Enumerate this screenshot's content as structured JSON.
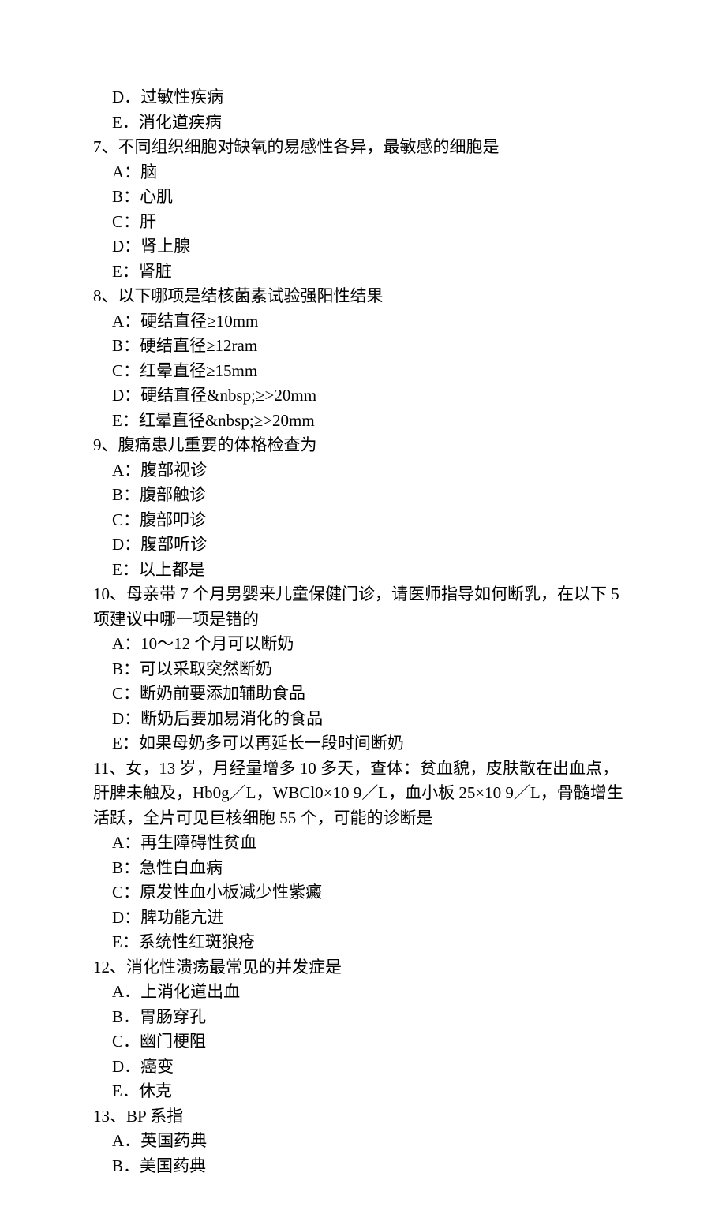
{
  "lines": [
    {
      "cls": "option-line",
      "text": "D．过敏性疾病"
    },
    {
      "cls": "option-line",
      "text": "E．消化道疾病"
    },
    {
      "cls": "question-line",
      "text": "7、不同组织细胞对缺氧的易感性各异，最敏感的细胞是"
    },
    {
      "cls": "option-line",
      "text": "A：脑"
    },
    {
      "cls": "option-line",
      "text": "B：心肌"
    },
    {
      "cls": "option-line",
      "text": "C：肝"
    },
    {
      "cls": "option-line",
      "text": "D：肾上腺"
    },
    {
      "cls": "option-line",
      "text": "E：肾脏"
    },
    {
      "cls": "question-line",
      "text": "8、以下哪项是结核菌素试验强阳性结果"
    },
    {
      "cls": "option-line",
      "text": "A：硬结直径≥10mm"
    },
    {
      "cls": "option-line",
      "text": "B：硬结直径≥12ram"
    },
    {
      "cls": "option-line",
      "text": "C：红晕直径≥15mm"
    },
    {
      "cls": "option-line",
      "text": "D：硬结直径&nbsp;≥>20mm"
    },
    {
      "cls": "option-line",
      "text": "E：红晕直径&nbsp;≥>20mm"
    },
    {
      "cls": "question-line",
      "text": "9、腹痛患儿重要的体格检查为"
    },
    {
      "cls": "option-line",
      "text": "A：腹部视诊"
    },
    {
      "cls": "option-line",
      "text": "B：腹部触诊"
    },
    {
      "cls": "option-line",
      "text": "C：腹部叩诊"
    },
    {
      "cls": "option-line",
      "text": "D：腹部听诊"
    },
    {
      "cls": "option-line",
      "text": "E：以上都是"
    },
    {
      "cls": "question-line",
      "text": "10、母亲带 7 个月男婴来儿童保健门诊，请医师指导如何断乳，在以下 5 项建议中哪一项是错的"
    },
    {
      "cls": "option-line",
      "text": "A：10～12 个月可以断奶"
    },
    {
      "cls": "option-line",
      "text": "B：可以采取突然断奶"
    },
    {
      "cls": "option-line",
      "text": "C：断奶前要添加辅助食品"
    },
    {
      "cls": "option-line",
      "text": "D：断奶后要加易消化的食品"
    },
    {
      "cls": "option-line",
      "text": "E：如果母奶多可以再延长一段时间断奶"
    },
    {
      "cls": "question-line",
      "text": "11、女，13 岁，月经量增多 10 多天，查体：贫血貌，皮肤散在出血点，肝脾未触及，Hb0g／L，WBCl0×10 9／L，血小板 25×10 9／L，骨髓增生活跃，全片可见巨核细胞 55 个，可能的诊断是"
    },
    {
      "cls": "option-line",
      "text": "A：再生障碍性贫血"
    },
    {
      "cls": "option-line",
      "text": "B：急性白血病"
    },
    {
      "cls": "option-line",
      "text": "C：原发性血小板减少性紫癜"
    },
    {
      "cls": "option-line",
      "text": "D：脾功能亢进"
    },
    {
      "cls": "option-line",
      "text": "E：系统性红斑狼疮"
    },
    {
      "cls": "question-line",
      "text": "12、消化性溃疡最常见的并发症是"
    },
    {
      "cls": "option-line",
      "text": "A．上消化道出血"
    },
    {
      "cls": "option-line",
      "text": "B．胃肠穿孔"
    },
    {
      "cls": "option-line",
      "text": "C．幽门梗阻"
    },
    {
      "cls": "option-line",
      "text": "D．癌变"
    },
    {
      "cls": "option-line",
      "text": "E．休克"
    },
    {
      "cls": "question-line",
      "text": "13、BP 系指"
    },
    {
      "cls": "option-line",
      "text": "A．英国药典"
    },
    {
      "cls": "option-line",
      "text": "B．美国药典"
    }
  ]
}
